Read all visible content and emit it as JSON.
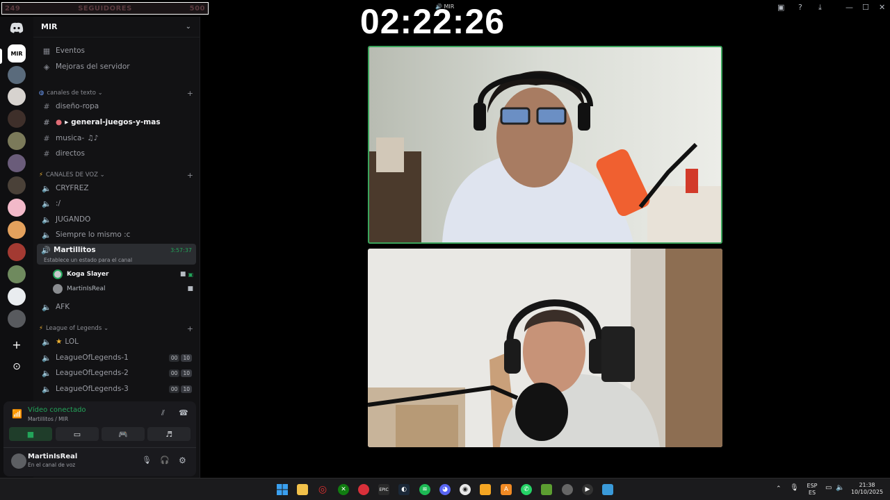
{
  "overlay": {
    "followers_min": "249",
    "followers_label": "SEGUIDORES",
    "followers_max": "500",
    "timer": "02:22:26"
  },
  "window": {
    "title": "MIR"
  },
  "server": {
    "name": "MIR",
    "top_items": [
      "Eventos",
      "Mejoras del servidor"
    ],
    "categories": {
      "text": "canales de texto",
      "voice": "CANALES DE VOZ",
      "lol": "League of Legends"
    },
    "text_channels": [
      "diseño-ropa",
      "▸ general-juegos-y-mas",
      "musica-",
      "directos"
    ],
    "voice_channels": [
      "CRYFREZ",
      ":/",
      "JUGANDO",
      "Siempre lo mismo :c"
    ],
    "active_channel": {
      "name": "Martillitos",
      "time": "3:57:37",
      "status": "Establece un estado para el canal"
    },
    "members": [
      "Koga Slayer",
      "MartinIsReal"
    ],
    "afk": "AFK",
    "lol_channels": [
      {
        "name": "LOL",
        "badges": []
      },
      {
        "name": "LeagueOfLegends-1",
        "badges": [
          "00",
          "10"
        ]
      },
      {
        "name": "LeagueOfLegends-2",
        "badges": [
          "00",
          "10"
        ]
      },
      {
        "name": "LeagueOfLegends-3",
        "badges": [
          "00",
          "10"
        ]
      }
    ]
  },
  "voice_panel": {
    "status": "Vídeo conectado",
    "location": "Martillitos / MIR"
  },
  "user": {
    "name": "MartinIsReal",
    "status": "En el canal de voz"
  },
  "taskbar": {
    "lang": "ESP",
    "region": "ES",
    "time": "21:38",
    "date": "10/10/2025"
  },
  "colors": {
    "accent_green": "#23a55a",
    "speaking_border": "#3ba55c",
    "discord_blurple": "#5865f2"
  }
}
